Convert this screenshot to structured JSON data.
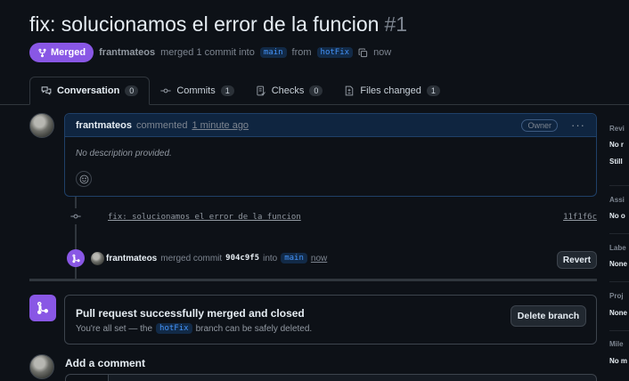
{
  "pr": {
    "title": "fix: solucionamos el error de la funcion",
    "number": "#1",
    "status": "Merged",
    "author": "frantmateos",
    "merge_text": "merged 1 commit into",
    "base_branch": "main",
    "from_text": "from",
    "head_branch": "hotFix",
    "time": "now"
  },
  "tabs": [
    {
      "label": "Conversation",
      "count": "0",
      "icon": "comment-discussion-icon"
    },
    {
      "label": "Commits",
      "count": "1",
      "icon": "commit-icon"
    },
    {
      "label": "Checks",
      "count": "0",
      "icon": "checklist-icon"
    },
    {
      "label": "Files changed",
      "count": "1",
      "icon": "file-diff-icon"
    }
  ],
  "comment": {
    "author": "frantmateos",
    "action": "commented",
    "time": "1 minute ago",
    "role": "Owner",
    "body": "No description provided."
  },
  "commit": {
    "message": "fix: solucionamos el error de la funcion",
    "sha": "11f1f6c"
  },
  "merge_event": {
    "author": "frantmateos",
    "text": "merged commit",
    "sha": "904c9f5",
    "into": "into",
    "branch": "main",
    "time": "now",
    "revert_label": "Revert"
  },
  "merge_status": {
    "title": "Pull request successfully merged and closed",
    "sub_prefix": "You're all set — the",
    "branch": "hotFix",
    "sub_suffix": "branch can be safely deleted.",
    "delete_label": "Delete branch"
  },
  "add_comment": {
    "label": "Add a comment"
  },
  "sidebar": {
    "reviewers": {
      "head": "Revi",
      "v1": "No r",
      "v2": "Still"
    },
    "assignees": {
      "head": "Assi",
      "v1": "No o"
    },
    "labels": {
      "head": "Labe",
      "v1": "None"
    },
    "projects": {
      "head": "Proj",
      "v1": "None"
    },
    "milestone": {
      "head": "Mile",
      "v1": "No m"
    }
  },
  "colors": {
    "merged": "#8957e5",
    "accent_blue": "#4493f8",
    "bg": "#0d1117"
  }
}
